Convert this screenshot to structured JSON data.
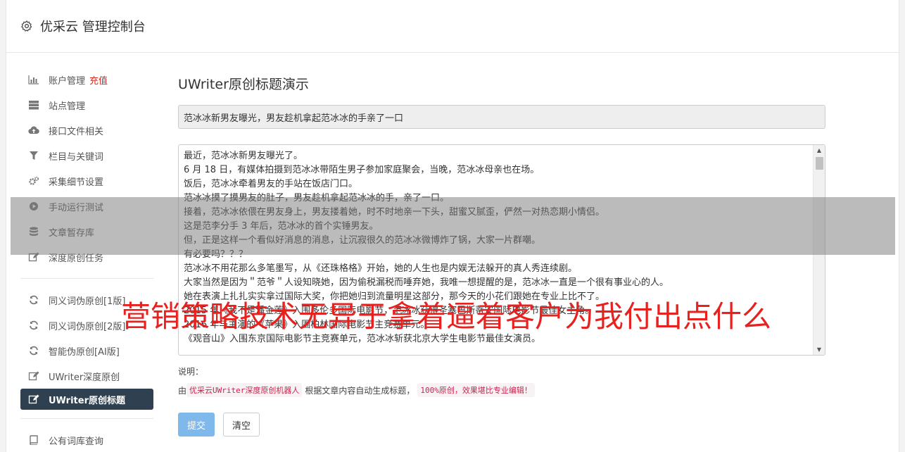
{
  "header": {
    "title": "优采云 管理控制台",
    "icon": "gear-icon"
  },
  "sidebar": {
    "items": [
      {
        "label": "账户管理",
        "accent": "充值",
        "icon": "bar-chart-icon"
      },
      {
        "label": "站点管理",
        "icon": "server-icon"
      },
      {
        "label": "接口文件相关",
        "icon": "cloud-upload-icon"
      },
      {
        "label": "栏目与关键词",
        "icon": "filter-icon"
      },
      {
        "label": "采集细节设置",
        "icon": "gears-icon"
      },
      {
        "label": "手动运行测试",
        "icon": "play-circle-icon"
      },
      {
        "label": "文章暂存库",
        "icon": "database-icon"
      },
      {
        "label": "深度原创任务",
        "icon": "edit-icon"
      },
      {
        "label": "同义词伪原创[1版]",
        "icon": "refresh-icon"
      },
      {
        "label": "同义词伪原创[2版]",
        "icon": "refresh-icon"
      },
      {
        "label": "智能伪原创[AI版]",
        "icon": "refresh-icon"
      },
      {
        "label": "UWriter深度原创",
        "icon": "edit-icon"
      },
      {
        "label": "UWriter原创标题",
        "icon": "edit-icon",
        "active": true
      },
      {
        "label": "公有词库查询",
        "icon": "book-icon"
      }
    ]
  },
  "main": {
    "title": "UWriter原创标题演示",
    "title_value": "范冰冰新男友曝光，男友趁机拿起范冰冰的手亲了一口",
    "content_lines": [
      "最近，范冰冰新男友曝光了。",
      "6 月 18 日，有媒体拍摄到范冰冰带陌生男子参加家庭聚会，当晚，范冰冰母亲也在场。",
      "饭后，范冰冰牵着男友的手站在饭店门口。",
      "范冰冰摸了摸男友的肚子，男友趁机拿起范冰冰的手，亲了一口。",
      "接着，范冰冰依偎在男友身上，男友搂着她，时不时地亲一下头，甜蜜又腻歪，俨然一对热恋期小情侣。",
      "这是范李分手 3 年后，范冰冰的首个实锤男友。",
      "但，正是这样一个看似好消息的消息，让沉寂很久的范冰冰微博炸了锅，大家一片群嘲。",
      "有必要吗？？？",
      "范冰冰不用花那么多笔墨写，从《还珠格格》开始，她的人生也是内娱无法躲开的真人秀连续剧。",
      "大家当然是因为＂范爷＂人设知晓她，因为偷税漏税而唾弃她，我唯一想提醒的是，范冰冰一直是一个很有事业心的人。",
      "她在表演上扎扎实实拿过国际大奖，你把她归到流量明星这部分，那今天的小花们跟她在专业上比不了。",
      "2015 年《我不是潘金莲》入围多伦多国际电影节，范冰冰获得圣塞巴斯蒂安国际电影节最佳女主角。",
      "2016 年与主演的《苹果》入围柏林国际电影节主竞赛单元。",
      "《观音山》入围东京国际电影节主竞赛单元，范冰冰斩获北京大学生电影节最佳女演员。"
    ],
    "note_label": "说明：",
    "note_prefix": "由",
    "note_code1": "优采云UWriter深度原创机器人",
    "note_mid": "根据文章内容自动生成标题，",
    "note_code2": "100%原创，效果堪比专业编辑！",
    "submit_label": "提交",
    "clear_label": "清空"
  },
  "overlay": {
    "text": "营销策略技术无异于拿着逼着客户为我付出点什么"
  },
  "colors": {
    "active_bg": "#2f4050",
    "accent_red": "#d9261c",
    "submit_bg": "#7fb8ea",
    "overlay_text": "#e8211f"
  }
}
